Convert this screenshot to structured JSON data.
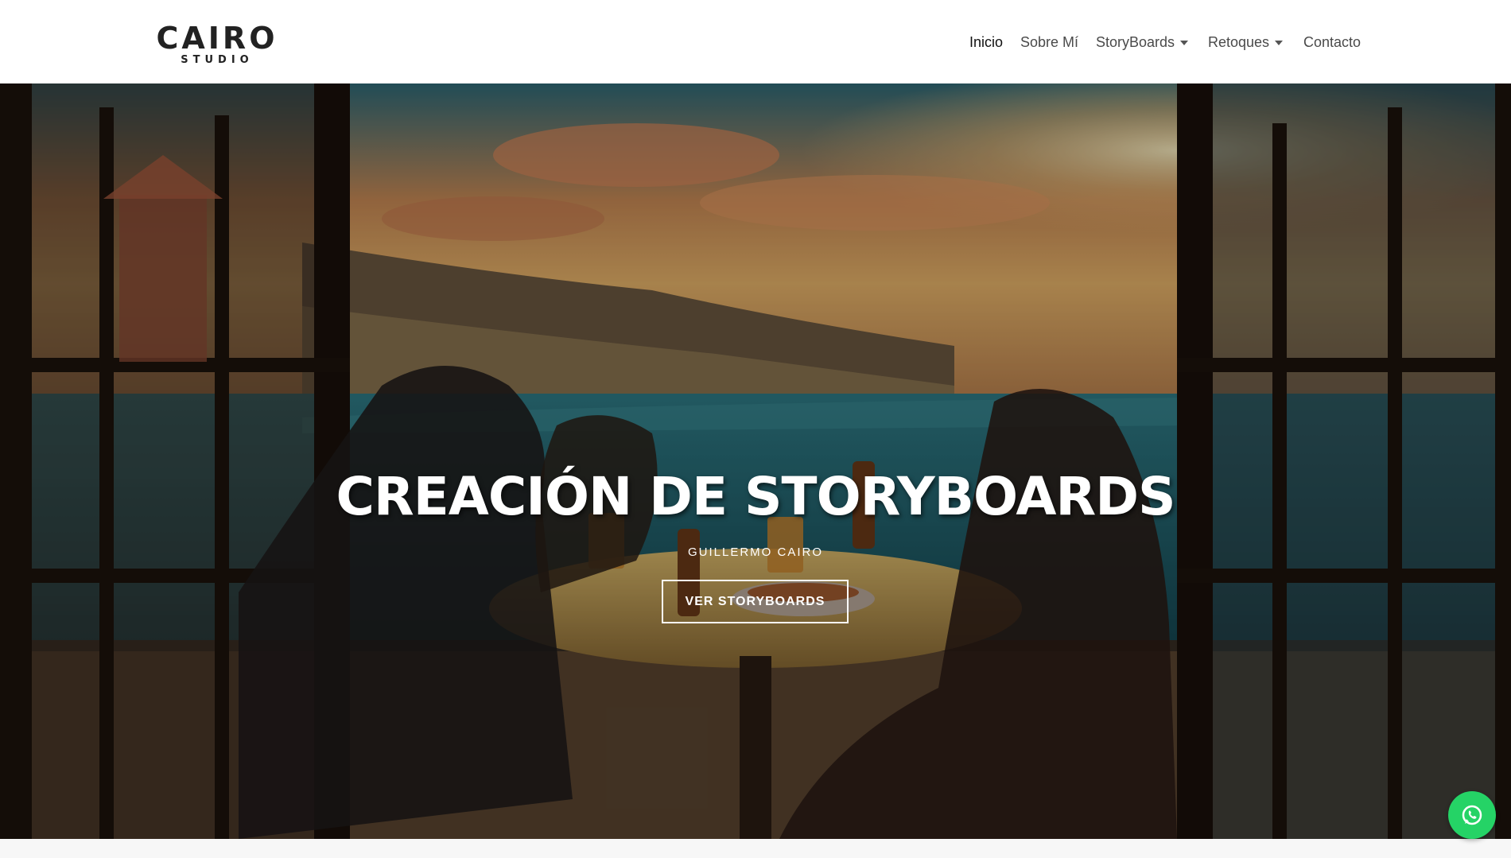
{
  "logo": {
    "main": "CAIRO",
    "sub": "STUDIO"
  },
  "nav": {
    "items": [
      {
        "label": "Inicio",
        "active": true,
        "dropdown": false
      },
      {
        "label": "Sobre Mí",
        "active": false,
        "dropdown": false
      },
      {
        "label": "StoryBoards",
        "active": false,
        "dropdown": true
      },
      {
        "label": "Retoques",
        "active": false,
        "dropdown": true
      },
      {
        "label": "Contacto",
        "active": false,
        "dropdown": false
      }
    ]
  },
  "hero": {
    "title": "CREACIÓN DE STORYBOARDS",
    "subtitle": "GUILLERMO CAIRO",
    "button_label": "VER STORYBOARDS"
  },
  "whatsapp": {
    "icon": "whatsapp-icon"
  },
  "colors": {
    "header_bg": "#ffffff",
    "nav_text": "#4a4a4a",
    "nav_active": "#111111",
    "whatsapp_green": "#25d366"
  }
}
